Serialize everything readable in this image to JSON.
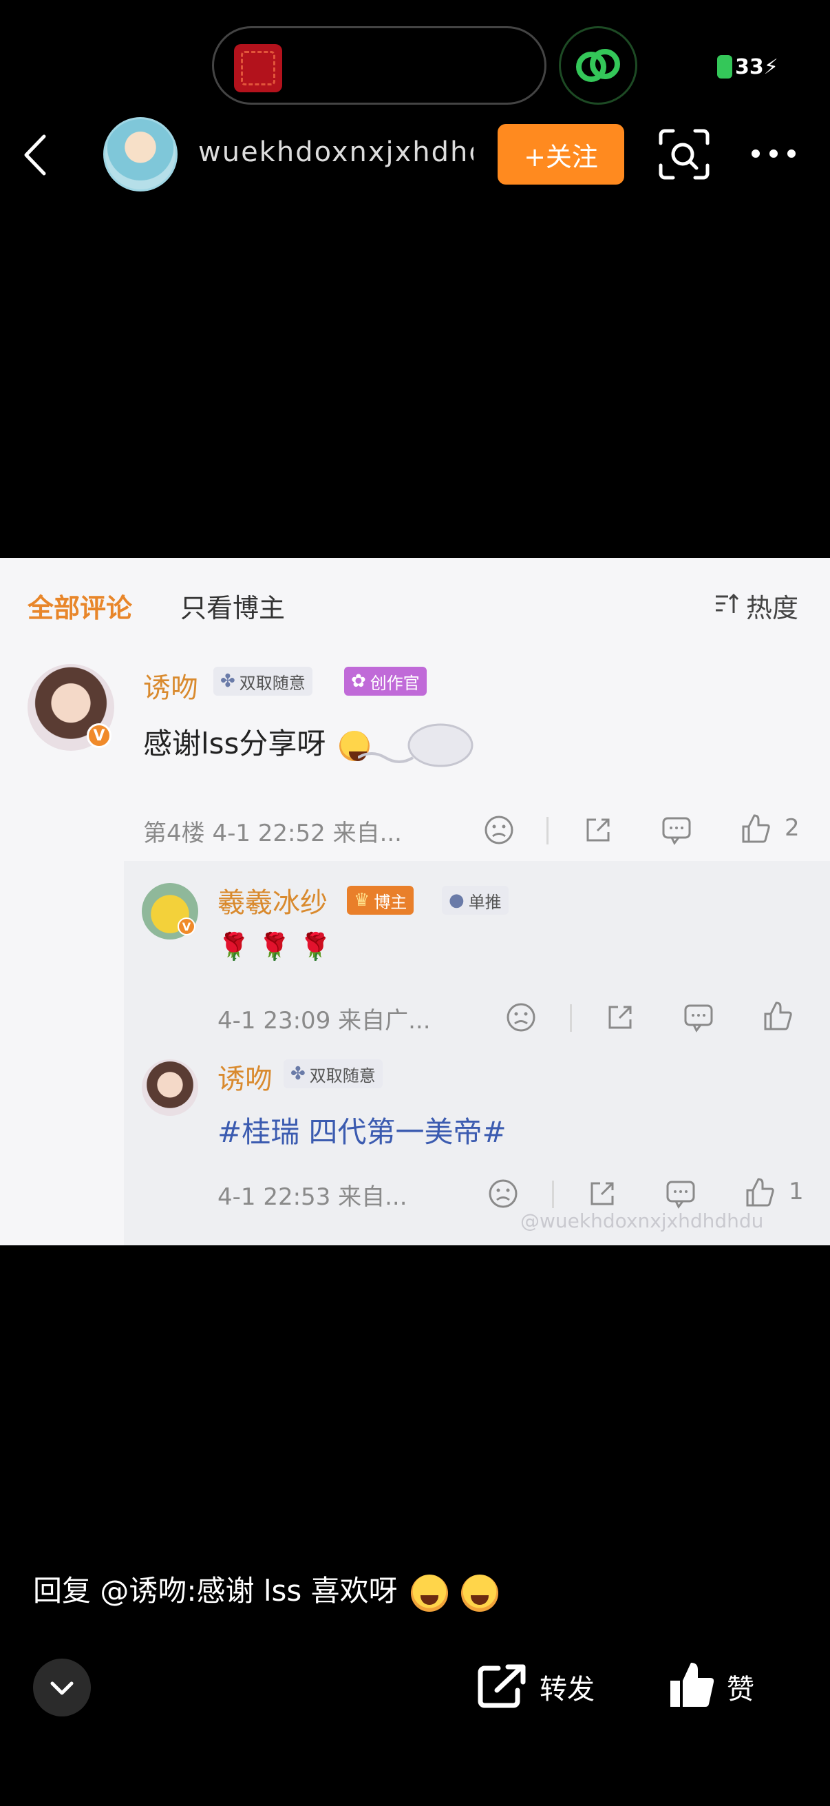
{
  "status": {
    "battery": "33"
  },
  "header": {
    "username": "wuekhdoxnxjxhdhdhdu...",
    "follow_label": "+关注"
  },
  "shot": {
    "tabs": {
      "all": "全部评论",
      "owner_only": "只看博主",
      "sort": "热度"
    },
    "comments": [
      {
        "nick": "诱吻",
        "tags": [
          "双取随意",
          "创作官"
        ],
        "text": "感谢lss分享呀",
        "meta": "第4楼  4-1 22:52  来自...",
        "likes": "2"
      },
      {
        "nick": "羲羲冰纱",
        "tags": [
          "博主",
          "单推"
        ],
        "text": "🌹 🌹 🌹",
        "meta": "4-1 23:09  来自广...",
        "likes": ""
      },
      {
        "nick": "诱吻",
        "tags": [
          "双取随意"
        ],
        "text": "#桂瑞 四代第一美帝#",
        "meta": "4-1 22:53  来自...",
        "likes": "1"
      }
    ],
    "watermark": "@wuekhdoxnxjxhdhdhdu"
  },
  "caption": "回复 @诱吻:感谢 lss 喜欢呀",
  "bottom": {
    "repost_label": "转发",
    "like_label": "赞"
  },
  "colors": {
    "accent": "#ff8a1f",
    "nick": "#d98a2e",
    "tab_active": "#e8862a"
  }
}
